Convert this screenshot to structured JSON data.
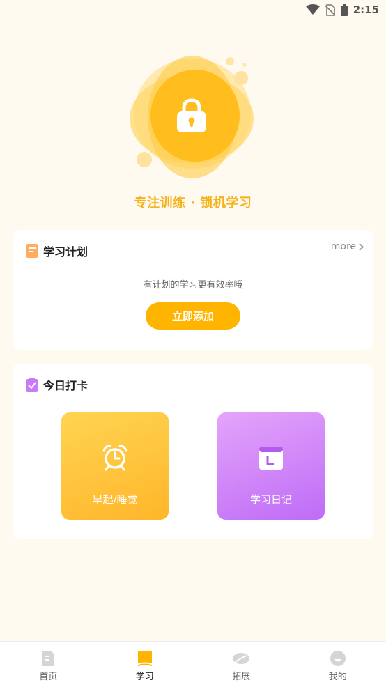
{
  "status_bar": {
    "time": "2:15"
  },
  "hero": {
    "slogan": "专注训练 · 锁机学习"
  },
  "plan": {
    "title": "学习计划",
    "more_label": "more",
    "hint": "有计划的学习更有效率哦",
    "add_button": "立即添加"
  },
  "checkin": {
    "title": "今日打卡",
    "tiles": [
      {
        "label": "早起/睡觉",
        "icon": "alarm-clock-icon"
      },
      {
        "label": "学习日记",
        "icon": "calendar-icon"
      }
    ]
  },
  "nav": {
    "items": [
      {
        "label": "首页",
        "icon": "document-icon",
        "active": false
      },
      {
        "label": "学习",
        "icon": "book-icon",
        "active": true
      },
      {
        "label": "拓展",
        "icon": "leaf-icon",
        "active": false
      },
      {
        "label": "我的",
        "icon": "smile-icon",
        "active": false
      }
    ]
  },
  "colors": {
    "accent": "#FFB400",
    "background": "#FFFAF0",
    "slogan": "#F5B21B",
    "diary_tile": "#C97AF7"
  }
}
